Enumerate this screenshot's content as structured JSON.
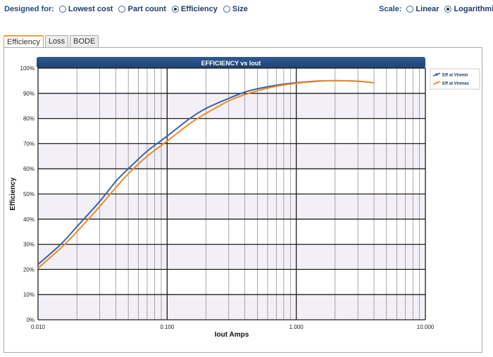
{
  "controls": {
    "designed_for_label": "Designed for:",
    "designed_for_options": [
      {
        "label": "Lowest cost",
        "selected": false
      },
      {
        "label": "Part count",
        "selected": false
      },
      {
        "label": "Efficiency",
        "selected": true
      },
      {
        "label": "Size",
        "selected": false
      }
    ],
    "scale_label": "Scale:",
    "scale_options": [
      {
        "label": "Linear",
        "selected": false
      },
      {
        "label": "Logarithmic",
        "selected": true
      }
    ]
  },
  "tabs": [
    {
      "label": "Efficiency",
      "active": true
    },
    {
      "label": "Loss",
      "active": false
    },
    {
      "label": "BODE",
      "active": false
    }
  ],
  "chart_data": {
    "type": "line",
    "title": "EFFICIENCY vs Iout",
    "xlabel": "Iout Amps",
    "ylabel": "Efficiency",
    "xscale": "log",
    "xlim": [
      0.01,
      10
    ],
    "ylim": [
      0,
      100
    ],
    "xticks": [
      "0.010",
      "0.100",
      "1.000",
      "10.000"
    ],
    "yticks": [
      "0%",
      "10%",
      "20%",
      "30%",
      "40%",
      "50%",
      "60%",
      "70%",
      "80%",
      "90%",
      "100%"
    ],
    "grid": true,
    "legend_position": "top-right",
    "series": [
      {
        "name": "Eff at Vinmin",
        "color": "#3a64a8",
        "x": [
          0.01,
          0.015,
          0.02,
          0.03,
          0.04,
          0.05,
          0.07,
          0.1,
          0.15,
          0.2,
          0.3,
          0.4,
          0.5,
          0.7,
          1.0,
          1.5,
          2.0,
          3.0,
          4.0
        ],
        "y": [
          22,
          30,
          37,
          47,
          55,
          60,
          67,
          73,
          80,
          84,
          88,
          90.5,
          91.8,
          93.2,
          94.2,
          94.9,
          95.0,
          94.8,
          94.2
        ]
      },
      {
        "name": "Eff at Vinmax",
        "color": "#f08a1e",
        "x": [
          0.01,
          0.015,
          0.02,
          0.03,
          0.04,
          0.05,
          0.07,
          0.1,
          0.15,
          0.2,
          0.3,
          0.4,
          0.5,
          0.7,
          1.0,
          1.5,
          2.0,
          3.0,
          4.0
        ],
        "y": [
          20.5,
          28.5,
          35,
          45,
          52.5,
          58,
          65,
          71,
          78,
          82,
          87,
          89.5,
          91,
          92.8,
          94,
          94.8,
          95.0,
          94.8,
          94.2
        ]
      }
    ]
  }
}
